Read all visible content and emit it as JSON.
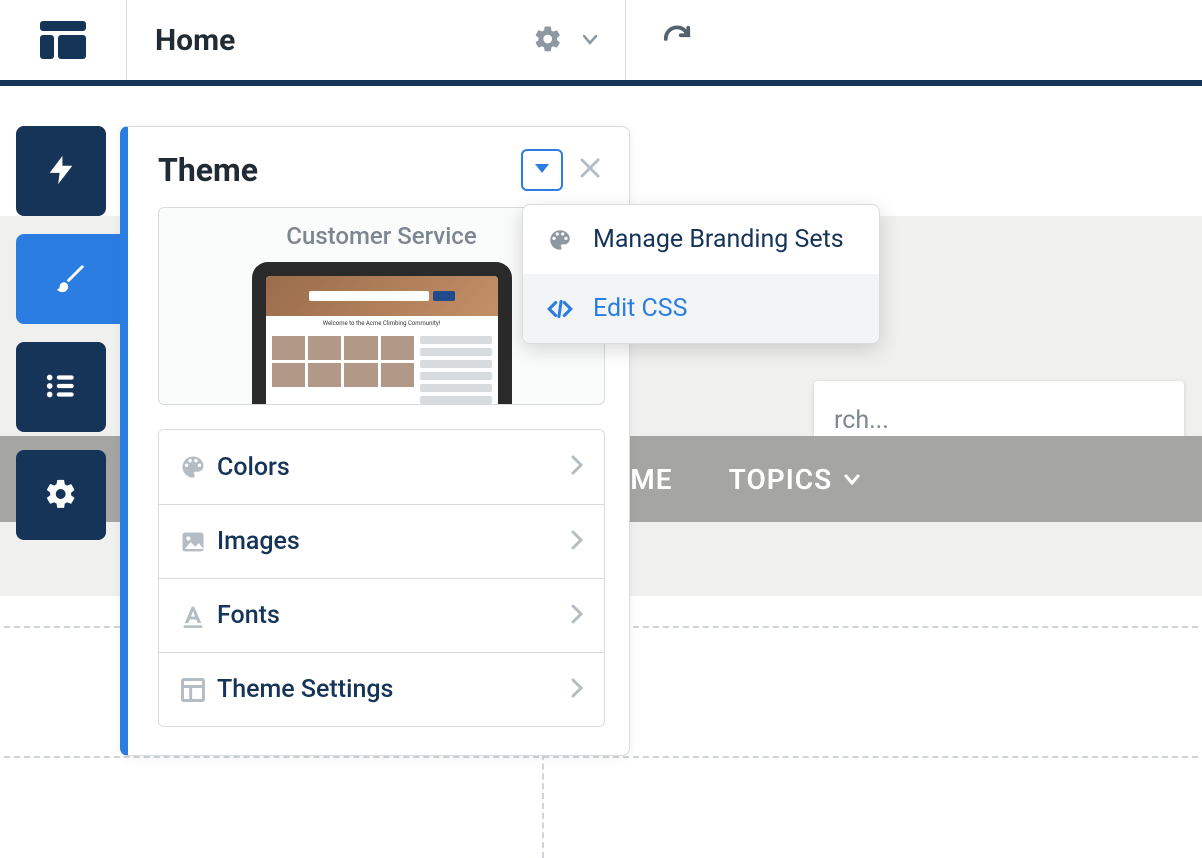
{
  "topbar": {
    "tab_title": "Home"
  },
  "theme_panel": {
    "title": "Theme",
    "preview_name": "Customer Service",
    "items": [
      {
        "label": "Colors"
      },
      {
        "label": "Images"
      },
      {
        "label": "Fonts"
      },
      {
        "label": "Theme Settings"
      }
    ]
  },
  "dropdown": {
    "items": [
      {
        "label": "Manage Branding Sets"
      },
      {
        "label": "Edit CSS"
      }
    ]
  },
  "site_preview": {
    "nav": [
      {
        "label": "HOME",
        "truncated": "OME"
      },
      {
        "label": "TOPICS"
      }
    ],
    "search_placeholder": "Search...",
    "search_placeholder_truncated": "rch..."
  }
}
